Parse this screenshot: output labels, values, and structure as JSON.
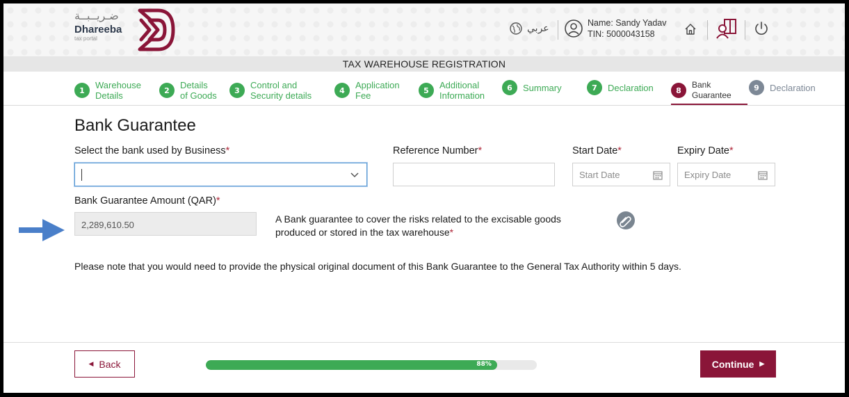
{
  "header": {
    "logo_arabic": "ضـريــبــة",
    "logo_name": "Dhareeba",
    "logo_sub": "tax portal",
    "language_label": "عربي",
    "user_name": "Name: Sandy Yadav",
    "user_tin": "TIN: 5000043158"
  },
  "page_header": "TAX WAREHOUSE REGISTRATION",
  "steps": [
    {
      "num": "1",
      "line1": "Warehouse",
      "line2": "Details",
      "state": "done"
    },
    {
      "num": "2",
      "line1": "Details",
      "line2": "of Goods",
      "state": "done"
    },
    {
      "num": "3",
      "line1": "Control and",
      "line2": "Security details",
      "state": "done"
    },
    {
      "num": "4",
      "line1": "Application",
      "line2": "Fee",
      "state": "done"
    },
    {
      "num": "5",
      "line1": "Additional",
      "line2": "Information",
      "state": "done"
    },
    {
      "num": "6",
      "line1": "Summary",
      "line2": "",
      "state": "done"
    },
    {
      "num": "7",
      "line1": "Declaration",
      "line2": "",
      "state": "done"
    },
    {
      "num": "8",
      "line1": "Bank",
      "line2": "Guarantee",
      "state": "active"
    },
    {
      "num": "9",
      "line1": "Declaration",
      "line2": "",
      "state": "pending"
    }
  ],
  "form": {
    "title": "Bank Guarantee",
    "bank_label": "Select the bank used by Business",
    "bank_value": "",
    "reference_label": "Reference Number",
    "reference_value": "",
    "start_label": "Start Date",
    "start_placeholder": "Start Date",
    "expiry_label": "Expiry Date",
    "expiry_placeholder": "Expiry Date",
    "amount_label": "Bank Guarantee Amount (QAR)",
    "amount_value": "2,289,610.50",
    "info_line1": "A Bank guarantee to cover the risks related to the excisable goods",
    "info_line2": "produced or stored in the tax warehouse",
    "required_mark": "*",
    "notice": "Please note that you would need to provide the physical original document of this Bank Guarantee to the General Tax Authority within 5 days."
  },
  "footer": {
    "back_label": "Back",
    "continue_label": "Continue",
    "progress_percent": 88,
    "progress_text": "88%"
  },
  "colors": {
    "brand": "#8a1538",
    "success": "#3daa55",
    "pending": "#7d8896",
    "annotation_arrow": "#4a7fc9"
  },
  "icons": [
    "globe-icon",
    "user-circle-icon",
    "home-icon",
    "book-user-icon",
    "power-icon",
    "chevron-down-icon",
    "calendar-icon",
    "paperclip-icon",
    "arrow-right-annotation"
  ]
}
